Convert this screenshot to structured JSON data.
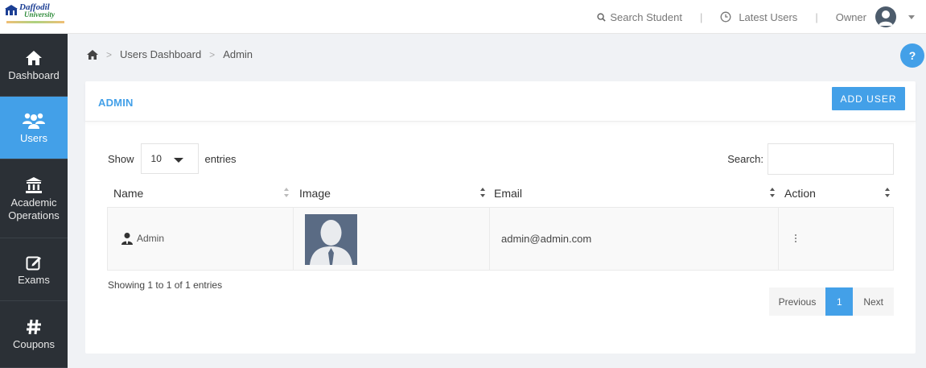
{
  "logo": {
    "title": "Daffodil",
    "subtitle": "University"
  },
  "topbar": {
    "search_label": "Search Student",
    "latest_label": "Latest Users",
    "user_label": "Owner"
  },
  "sidebar": {
    "items": [
      {
        "label": "Dashboard",
        "icon": "home-icon"
      },
      {
        "label": "Users",
        "icon": "users-icon"
      },
      {
        "label_line1": "Academic",
        "label_line2": "Operations",
        "icon": "institution-icon"
      },
      {
        "label": "Exams",
        "icon": "edit-icon"
      },
      {
        "label": "Coupons",
        "icon": "hashtag-icon"
      }
    ],
    "active_index": 1
  },
  "breadcrumb": {
    "level1": "Users Dashboard",
    "level2": "Admin"
  },
  "card": {
    "title": "ADMIN",
    "add_button": "ADD USER"
  },
  "table_controls": {
    "show_label": "Show",
    "entries_value": "10",
    "entries_label": "entries",
    "search_label": "Search:",
    "search_value": ""
  },
  "table": {
    "columns": [
      "Name",
      "Image",
      "Email",
      "Action"
    ],
    "rows": [
      {
        "name": "Admin",
        "email": "admin@admin.com"
      }
    ]
  },
  "footer": {
    "info": "Showing 1 to 1 of 1 entries",
    "prev": "Previous",
    "page": "1",
    "next": "Next"
  },
  "help": "?",
  "colors": {
    "accent": "#43a0e8",
    "sidebar": "#2b3036"
  }
}
